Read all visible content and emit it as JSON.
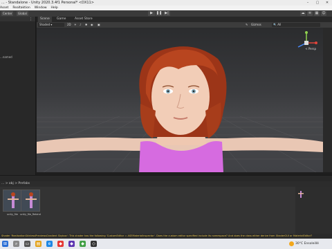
{
  "window": {
    "title": "... - Standalone - Unity 2020.3.4f1 Personal* <DX11>",
    "controls": [
      "–",
      "▢",
      "✕"
    ]
  },
  "menu": [
    "Asset",
    "Realtaktion",
    "Window",
    "Help"
  ],
  "toolbar": {
    "left_buttons": [
      "Center",
      "Global"
    ],
    "play": "▶",
    "pause": "❚❚",
    "step": "▶|"
  },
  "scene_tabs": [
    "Scene",
    "Game",
    "Asset Store"
  ],
  "scene_bar": {
    "shading_mode": "Shaded",
    "mode_2d": "2D",
    "gizmos_label": "Gizmos",
    "search_placeholder": "All"
  },
  "gizmo": {
    "persp_label": "< Persp"
  },
  "left_panel": {
    "item": "...named"
  },
  "project": {
    "breadcrumb": "... > obj > Prefabs"
  },
  "assets": [
    {
      "label": "unity_file"
    },
    {
      "label": "unity_file_Rebind"
    }
  ],
  "status_message": "Shader 'RealisationSkinlessPreviewsGradient Skybox': This shader has the following 'CustomEditor = ASEMaterialInspector'. Does the custom editor specified include its namespace? And does the class either derive from ShaderGUI or MaterialEditor?",
  "taskbar": {
    "temperature": "30°C",
    "weather": "Ensoleillé"
  },
  "colors": {
    "viewport_bg": "#3a3b3e",
    "accent": "#4a8cff",
    "warning": "#e8c34a",
    "hair": "#b8451f",
    "top": "#d66be0"
  }
}
